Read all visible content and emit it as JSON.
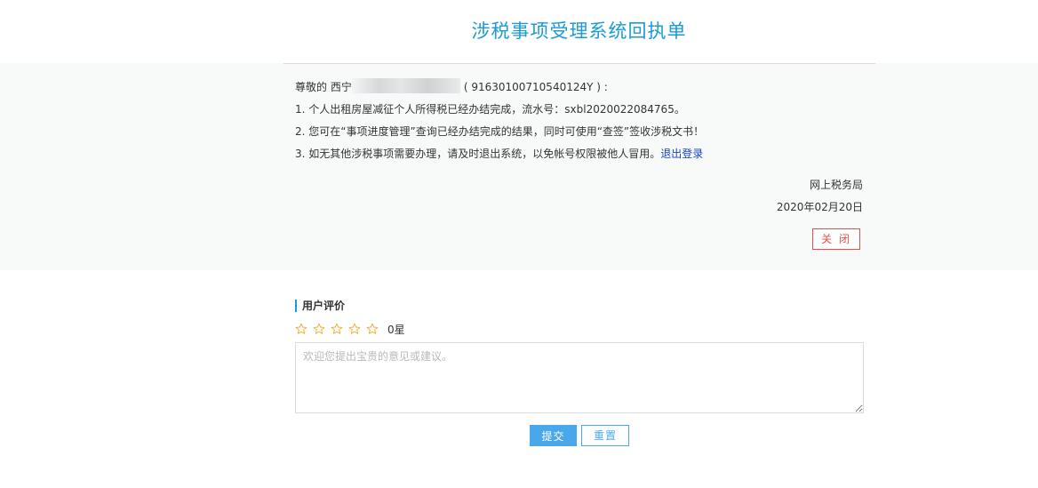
{
  "title": "涉税事项受理系统回执单",
  "receipt": {
    "greeting_prefix": "尊敬的 西宁",
    "taxpayer_id": "( 91630100710540124Y ) :",
    "line1": "1. 个人出租房屋减征个人所得税已经办结完成，流水号：sxbl2020022084765。",
    "line2": "2. 您可在“事项进度管理”查询已经办结完成的结果，同时可使用“查签”签收涉税文书！",
    "line3_text": "3. 如无其他涉税事项需要办理，请及时退出系统，以免帐号权限被他人冒用。",
    "logout_link": "退出登录",
    "office": "网上税务局",
    "date": "2020年02月20日",
    "close_label": "关 闭"
  },
  "review": {
    "heading": "用户评价",
    "rating": 0,
    "max_rating": 5,
    "rating_text": "0星",
    "placeholder": "欢迎您提出宝贵的意见或建议。",
    "value": "",
    "submit_label": "提交",
    "reset_label": "重置"
  },
  "colors": {
    "title": "#1b9bd8",
    "link": "#1a40c8",
    "close": "#e3504a",
    "primary": "#4aa8ea",
    "star": "#f0a92e"
  },
  "icons": {
    "star": "star-outline-icon"
  }
}
